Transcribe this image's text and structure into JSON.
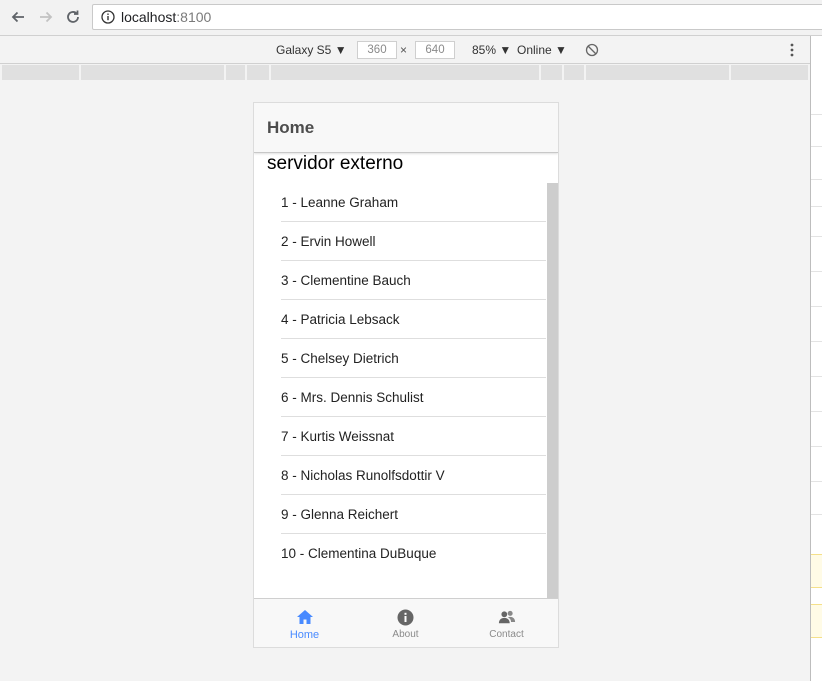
{
  "browser": {
    "url_host": "localhost",
    "url_port": ":8100"
  },
  "devtools": {
    "device": "Galaxy S5 ▼",
    "width": "360",
    "times": "×",
    "height": "640",
    "zoom": "85% ▼",
    "network": "Online ▼"
  },
  "app": {
    "header_title": "Home",
    "section_title": "servidor externo",
    "items": [
      "1 - Leanne Graham",
      "2 - Ervin Howell",
      "3 - Clementine Bauch",
      "4 - Patricia Lebsack",
      "5 - Chelsey Dietrich",
      "6 - Mrs. Dennis Schulist",
      "7 - Kurtis Weissnat",
      "8 - Nicholas Runolfsdottir V",
      "9 - Glenna Reichert",
      "10 - Clementina DuBuque"
    ],
    "tabs": [
      {
        "label": "Home",
        "icon": "home-icon"
      },
      {
        "label": "About",
        "icon": "info-icon"
      },
      {
        "label": "Contact",
        "icon": "contacts-icon"
      }
    ]
  },
  "colors": {
    "accent": "#488aff",
    "inactive": "#8a8a8a"
  }
}
